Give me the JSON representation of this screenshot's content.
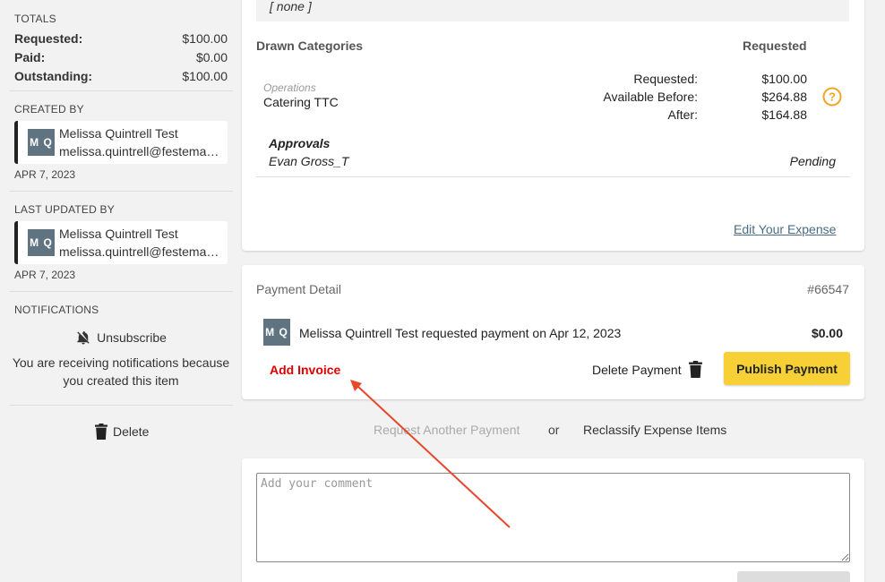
{
  "totals": {
    "title": "TOTALS",
    "rows": [
      {
        "label": "Requested:",
        "value": "$100.00"
      },
      {
        "label": "Paid:",
        "value": "$0.00"
      },
      {
        "label": "Outstanding:",
        "value": "$100.00"
      }
    ]
  },
  "created_by": {
    "title": "CREATED BY",
    "initials": "M Q",
    "name": "Melissa Quintrell Test",
    "email": "melissa.quintrell@festema…",
    "date": "APR 7, 2023"
  },
  "last_updated_by": {
    "title": "LAST UPDATED BY",
    "initials": "M Q",
    "name": "Melissa Quintrell Test",
    "email": "melissa.quintrell@festema…",
    "date": "APR 7, 2023"
  },
  "notifications": {
    "title": "NOTIFICATIONS",
    "unsubscribe_label": "Unsubscribe",
    "message": "You are receiving notifications because you created this item"
  },
  "sidebar_delete_label": "Delete",
  "expense": {
    "none_text": "[ none ]",
    "drawn_categories_label": "Drawn Categories",
    "requested_header": "Requested",
    "category_group": "Operations",
    "category_name": "Catering TTC",
    "amounts": [
      {
        "label": "Requested:",
        "value": "$100.00"
      },
      {
        "label": "Available Before:",
        "value": "$264.88"
      },
      {
        "label": "After:",
        "value": "$164.88"
      }
    ],
    "approvals_label": "Approvals",
    "approver": "Evan Gross_T",
    "approval_status": "Pending",
    "edit_link": "Edit Your Expense"
  },
  "payment": {
    "title": "Payment Detail",
    "number": "#66547",
    "initials": "M Q",
    "request_text": "Melissa Quintrell Test requested payment on Apr 12, 2023",
    "amount": "$0.00",
    "add_invoice": "Add Invoice",
    "delete_payment": "Delete Payment",
    "publish_payment": "Publish Payment"
  },
  "actions": {
    "request_another": "Request Another Payment",
    "or": "or",
    "reclassify": "Reclassify Expense Items"
  },
  "comment": {
    "placeholder": "Add your comment"
  },
  "colors": {
    "accent_yellow": "#f7d035",
    "invoice_red": "#e00000",
    "arrow_red": "#e8472b",
    "avatar_slate": "#5f7480",
    "help_orange": "#f0a51e"
  }
}
